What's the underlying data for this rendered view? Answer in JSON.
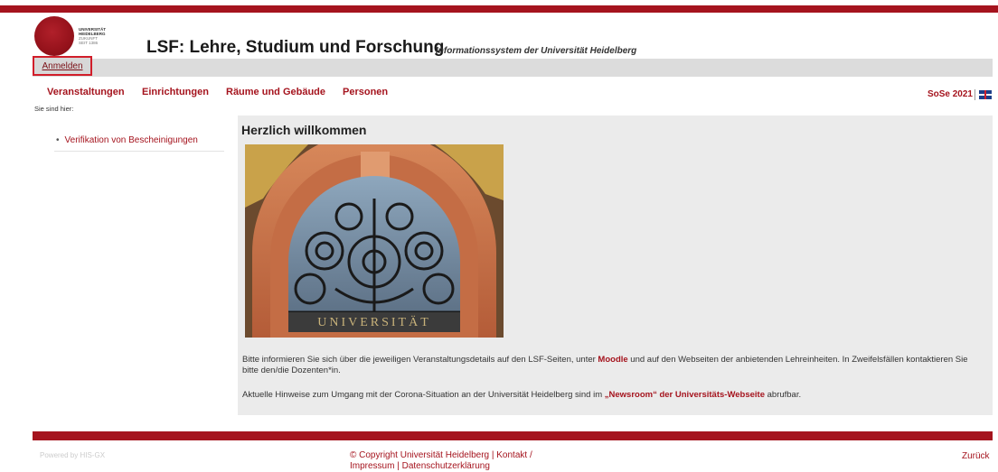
{
  "header": {
    "logo_lines": [
      "UNIVERSITÄT",
      "HEIDELBERG",
      "ZUKUNFT",
      "SEIT 1386"
    ],
    "title": "LSF: Lehre, Studium und Forschung",
    "subtitle": "Informationssystem der Universität Heidelberg",
    "login_label": "Anmelden"
  },
  "nav": {
    "items": [
      "Veranstaltungen",
      "Einrichtungen",
      "Räume und Gebäude",
      "Personen"
    ],
    "semester": "SoSe 2021"
  },
  "breadcrumb": "Sie sind hier:",
  "sidebar": {
    "items": [
      "Verifikation von Bescheinigungen"
    ]
  },
  "main": {
    "title": "Herzlich willkommen",
    "image_text": "UNIVERSITÄT",
    "p1_before": "Bitte informieren Sie sich über die jeweiligen Veranstaltungsdetails auf den LSF-Seiten, unter ",
    "p1_link": "Moodle",
    "p1_after": " und auf den Webseiten der anbietenden Lehreinheiten. In Zweifelsfällen kontaktieren Sie bitte den/die Dozenten*in.",
    "p2_before": "Aktuelle Hinweise zum Umgang mit der Corona-Situation an der Universität Heidelberg sind im ",
    "p2_link": "„Newsroom“ der Universitäts-Webseite",
    "p2_after": " abrufbar."
  },
  "footer": {
    "left": "Powered by HIS-GX",
    "copyright": "© Copyright Universität Heidelberg",
    "kontakt": "Kontakt",
    "impressum": "Impressum",
    "datenschutz": "Datenschutzerklärung",
    "back": "Zurück"
  },
  "colors": {
    "brand": "#a5141e",
    "login_outline": "#d11e2a",
    "content_bg": "#ebebeb"
  }
}
